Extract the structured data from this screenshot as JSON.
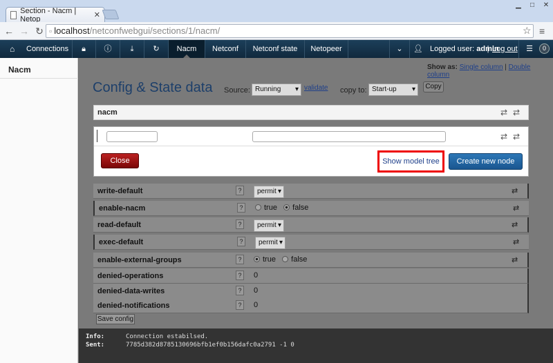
{
  "browser": {
    "tab_title": "Section - Nacm | Netop",
    "url_host": "localhost",
    "url_path": "/netconfwebgui/sections/1/nacm/"
  },
  "navbar": {
    "connections": "Connections",
    "tabs": [
      "Nacm",
      "Netconf",
      "Netconf state",
      "Netopeer"
    ],
    "logged_user_label": "Logged user:",
    "user": "admin",
    "logout": "Log out",
    "badge": "0"
  },
  "sidebar": {
    "items": [
      "Nacm"
    ]
  },
  "main": {
    "show_as_label": "Show as:",
    "single_column": "Single column",
    "double_column": "Double column",
    "title": "Config & State data",
    "source_label": "Source:",
    "source_value": "Running",
    "validate": "validate",
    "copy_to_label": "copy to:",
    "copy_to_value": "Start-up",
    "copy_button": "Copy",
    "section": "nacm"
  },
  "dialog": {
    "close": "Close",
    "show_model_tree": "Show model tree",
    "create_new_node": "Create new node"
  },
  "rows": [
    {
      "name": "write-default",
      "q": "?",
      "value": "permit"
    },
    {
      "name": "enable-nacm",
      "q": "?",
      "opt1": "true",
      "opt2": "false"
    },
    {
      "name": "read-default",
      "q": "?",
      "value": "permit"
    },
    {
      "name": "exec-default",
      "q": "?",
      "value": "permit"
    },
    {
      "name": "enable-external-groups",
      "q": "?",
      "opt1": "true",
      "opt2": "false"
    },
    {
      "name": "denied-operations",
      "q": "?",
      "value": "0"
    },
    {
      "name": "denied-data-writes",
      "q": "?",
      "value": "0"
    },
    {
      "name": "denied-notifications",
      "q": "?",
      "value": "0"
    }
  ],
  "save_config": "Save config",
  "console": {
    "info_label": "Info:",
    "info": "Connection estabilsed.",
    "sent_label": "Sent:",
    "sent": "7785d382d8785130696bfb1ef0b156dafc0a2791 -1 0"
  }
}
